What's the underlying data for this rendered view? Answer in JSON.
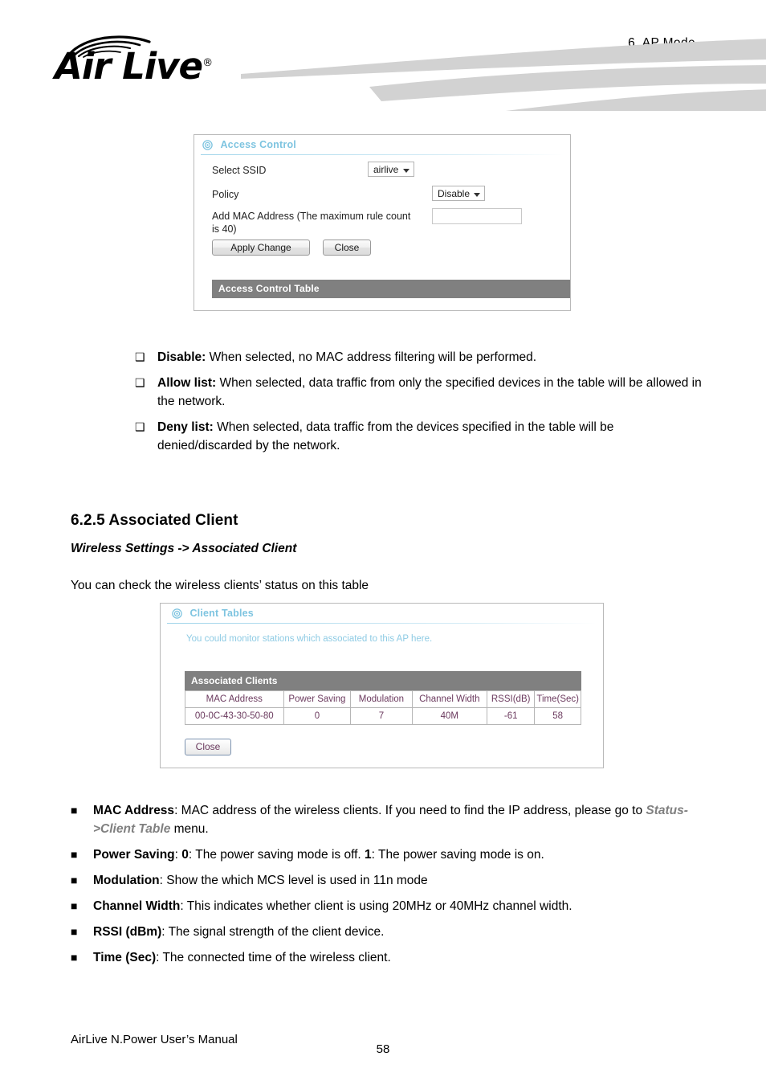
{
  "header": {
    "logo_text": "Air Live",
    "logo_registered": "®",
    "chapter": "6.  AP  Mode"
  },
  "access_control_panel": {
    "title": "Access Control",
    "icon": "target-icon",
    "fields": {
      "ssid_label": "Select SSID",
      "ssid_value": "airlive",
      "policy_label": "Policy",
      "policy_value": "Disable",
      "mac_label": "Add MAC Address (The maximum rule count is 40)",
      "mac_value": ""
    },
    "apply_button": "Apply Change",
    "close_button": "Close",
    "table_bar": "Access Control Table"
  },
  "policy_bullets": [
    {
      "glyph": "❑",
      "term": "Disable:",
      "text": " When selected, no MAC address filtering will be performed."
    },
    {
      "glyph": "❑",
      "term": "Allow list:",
      "text": " When selected, data traffic from only the specified devices in the table will be allowed in the network."
    },
    {
      "glyph": "❑",
      "term": "Deny list:",
      "text": " When selected, data traffic from the devices specified in the table will be denied/discarded by the network."
    }
  ],
  "section": {
    "number_title": "6.2.5 Associated Client",
    "breadcrumb": "Wireless Settings -> Associated Client",
    "intro": "You can check the wireless clients’ status on this table"
  },
  "client_tables_panel": {
    "title": "Client Tables",
    "icon": "target-icon",
    "subtitle": "You could monitor stations which associated to this AP here.",
    "table_bar": "Associated Clients",
    "columns": [
      "MAC Address",
      "Power Saving",
      "Modulation",
      "Channel Width",
      "RSSI(dB)",
      "Time(Sec)"
    ],
    "rows": [
      [
        "00-0C-43-30-50-80",
        "0",
        "7",
        "40M",
        "-61",
        "58"
      ]
    ],
    "close_button": "Close"
  },
  "field_bullets": [
    {
      "glyph": "■",
      "term": "MAC Address",
      "pre": ":   MAC address of the wireless clients.   If you need to find the IP address, please go to ",
      "path": "Status->Client Table",
      "post": " menu."
    },
    {
      "glyph": "■",
      "term": "Power Saving",
      "pre": ":   ",
      "bold1": "0",
      "mid1": ": The power saving mode is off.   ",
      "bold2": "1",
      "mid2": ": The power saving mode is on."
    },
    {
      "glyph": "■",
      "term": "Modulation",
      "pre": ":   Show the which MCS level is used in 11n mode"
    },
    {
      "glyph": "■",
      "term": "Channel Width",
      "pre": ":   This indicates whether client is using 20MHz or 40MHz channel width."
    },
    {
      "glyph": "■",
      "term": "RSSI (dBm)",
      "pre": ":   The signal strength of the client device."
    },
    {
      "glyph": "■",
      "term": "Time (Sec)",
      "pre": ":   The connected time of the wireless client."
    }
  ],
  "footer": {
    "manual_title": "AirLive N.Power User’s Manual",
    "page_number": "58"
  },
  "colors": {
    "panel_title_blue": "#7ec4e0",
    "subtitle_blue": "#8ecbe4",
    "gray_bar": "#808080",
    "table_text": "#6b3a5e",
    "swoosh_gray": "#d2d2d2"
  }
}
